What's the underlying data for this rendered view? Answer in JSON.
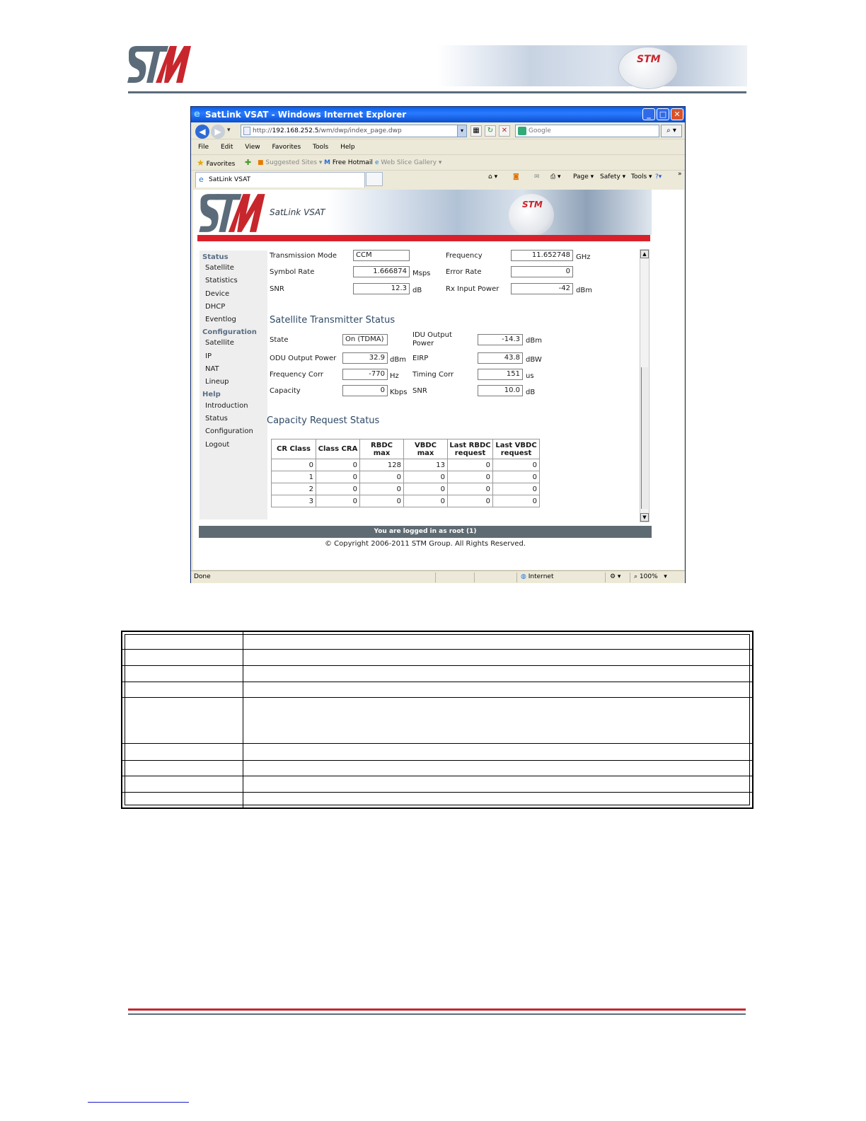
{
  "document": {
    "logo": "STM",
    "banner_logo": "STM"
  },
  "browser": {
    "title": "SatLink VSAT - Windows Internet Explorer",
    "address_prefix": "http://",
    "address_host": "192.168.252.5",
    "address_path": "/wm/dwp/index_page.dwp",
    "search_placeholder": "Google",
    "menu": [
      "File",
      "Edit",
      "View",
      "Favorites",
      "Tools",
      "Help"
    ],
    "favorites_label": "Favorites",
    "suggested_sites": "Suggested Sites ▾",
    "free_hotmail": "Free Hotmail",
    "web_slice_gallery": "Web Slice Gallery ▾",
    "tab_label": "SatLink VSAT",
    "commands": {
      "page": "Page ▾",
      "safety": "Safety ▾",
      "tools": "Tools ▾",
      "help": "?▾",
      "more": "»"
    },
    "status": {
      "left": "Done",
      "zone": "Internet",
      "zoom": "100%"
    }
  },
  "site": {
    "logo": "STM",
    "title": "SatLink VSAT",
    "sidebar": {
      "status_group": "Status",
      "status_items": [
        "Satellite",
        "Statistics",
        "Device",
        "DHCP",
        "Eventlog"
      ],
      "config_group": "Configuration",
      "config_items": [
        "Satellite",
        "IP",
        "NAT",
        "Lineup"
      ],
      "help_group": "Help",
      "help_items": [
        "Introduction",
        "Status",
        "Configuration"
      ],
      "logout": "Logout"
    },
    "receiver": {
      "transmission_mode_label": "Transmission Mode",
      "transmission_mode": "CCM",
      "frequency_label": "Frequency",
      "frequency": "11.652748",
      "frequency_unit": "GHz",
      "symbol_rate_label": "Symbol Rate",
      "symbol_rate": "1.666874",
      "symbol_rate_unit": "Msps",
      "error_rate_label": "Error Rate",
      "error_rate": "0",
      "snr_label": "SNR",
      "snr": "12.3",
      "snr_unit": "dB",
      "rx_power_label": "Rx Input Power",
      "rx_power": "-42",
      "rx_power_unit": "dBm"
    },
    "transmitter": {
      "title": "Satellite Transmitter Status",
      "state_label": "State",
      "state": "On (TDMA)",
      "idu_power_label_1": "IDU Output",
      "idu_power_label_2": "Power",
      "idu_power": "-14.3",
      "idu_power_unit": "dBm",
      "odu_power_label": "ODU Output Power",
      "odu_power": "32.9",
      "odu_power_unit": "dBm",
      "eirp_label": "EIRP",
      "eirp": "43.8",
      "eirp_unit": "dBW",
      "freq_corr_label": "Frequency Corr",
      "freq_corr": "-770",
      "freq_corr_unit": "Hz",
      "timing_corr_label": "Timing Corr",
      "timing_corr": "151",
      "timing_corr_unit": "us",
      "capacity_label": "Capacity",
      "capacity": "0",
      "capacity_unit": "Kbps",
      "snr_label": "SNR",
      "snr": "10.0",
      "snr_unit": "dB"
    },
    "capacity_request": {
      "title": "Capacity Request Status",
      "headers": [
        "CR Class",
        "Class CRA",
        "RBDC max",
        "VBDC max",
        "Last RBDC request",
        "Last VBDC request"
      ],
      "rows": [
        [
          "0",
          "0",
          "128",
          "13",
          "0",
          "0"
        ],
        [
          "1",
          "0",
          "0",
          "0",
          "0",
          "0"
        ],
        [
          "2",
          "0",
          "0",
          "0",
          "0",
          "0"
        ],
        [
          "3",
          "0",
          "0",
          "0",
          "0",
          "0"
        ]
      ]
    },
    "login_status": "You are logged in as root (1)",
    "copyright": "© Copyright 2006-2011 STM Group. All Rights Reserved."
  },
  "colors": {
    "brand_red": "#c8262d",
    "brand_gray": "#5b6b7a"
  }
}
